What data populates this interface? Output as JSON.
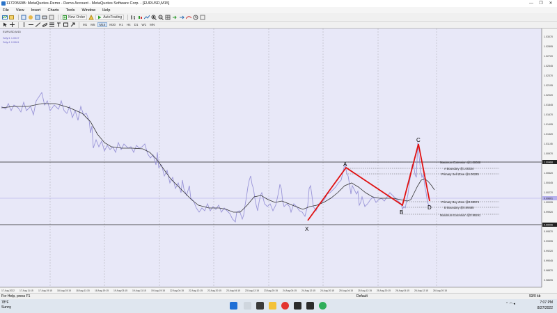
{
  "window": {
    "title": "11720569B: MetaQuotes-Demo - Demo Account - MetaQuotes Software Corp. - [EURUSD,M15]",
    "controls": [
      "—",
      "❐",
      "✕"
    ]
  },
  "menu": [
    "File",
    "View",
    "Insert",
    "Charts",
    "Tools",
    "Window",
    "Help"
  ],
  "toolbar": {
    "new_order": "New Order",
    "autotrading": "AutoTrading",
    "timeframes": [
      "M1",
      "M5",
      "M15",
      "M30",
      "H1",
      "H4",
      "D1",
      "W1",
      "MN"
    ]
  },
  "chart": {
    "symbol_label": "EURUSD,M15",
    "ma_label_1": "Sdlyr1 1.0047",
    "ma_label_2": "Sdlyr1 0.9961",
    "price_axis": [
      "1.03070",
      "1.02895",
      "1.02720",
      "1.02545",
      "1.02370",
      "1.02195",
      "1.02020",
      "1.01845",
      "1.01670",
      "1.01495",
      "1.01320",
      "1.01145",
      "1.00970",
      "1.00795",
      "1.00620",
      "1.00445",
      "1.00270",
      "1.00095",
      "0.99920",
      "0.99745",
      "0.99570",
      "0.99395",
      "0.99220",
      "0.99045",
      "0.98870",
      "0.98695",
      "0.98520"
    ],
    "price_tag_top": "1.00468",
    "price_tag_bottom": "0.99006",
    "price_tag_current": "0.99601",
    "time_axis": [
      "17 Aug 2022",
      "17 Aug 11:15",
      "17 Aug 19:15",
      "18 Aug 03:15",
      "18 Aug 11:15",
      "18 Aug 19:15",
      "19 Aug 03:15",
      "19 Aug 11:15",
      "19 Aug 19:15",
      "22 Aug 04:15",
      "22 Aug 12:15",
      "22 Aug 20:15",
      "23 Aug 04:15",
      "23 Aug 12:15",
      "23 Aug 20:15",
      "24 Aug 04:15",
      "24 Aug 12:15",
      "24 Aug 20:15",
      "25 Aug 04:15",
      "25 Aug 12:15",
      "25 Aug 20:15",
      "26 Aug 04:15",
      "26 Aug 12:15",
      "26 Aug 20:15"
    ],
    "pattern_points": {
      "x": "X",
      "a": "A",
      "b": "B",
      "c": "C",
      "d": "D"
    },
    "levels": {
      "max_ext_top": "Maximum Extension @1.00608",
      "a_boundary": "A Boundary @1.00334",
      "primary_sell": "Primary Sell Zone @1.00225",
      "primary_buy": "Primary Buy Zone @0.99574",
      "b_boundary": "B Boundary @0.99465",
      "max_ext_bottom": "Maximum Extension @0.99291"
    },
    "colors": {
      "background": "#e8e8f8",
      "price": "#9a95d8",
      "ma": "#333333",
      "pattern": "#e01010"
    }
  },
  "status": {
    "help": "For Help, press F1",
    "profile": "Default",
    "traffic": "93/0 kb"
  },
  "taskbar": {
    "weather_temp": "78°F",
    "weather_desc": "Sunny",
    "time": "7:07 PM",
    "date": "8/27/2022"
  }
}
